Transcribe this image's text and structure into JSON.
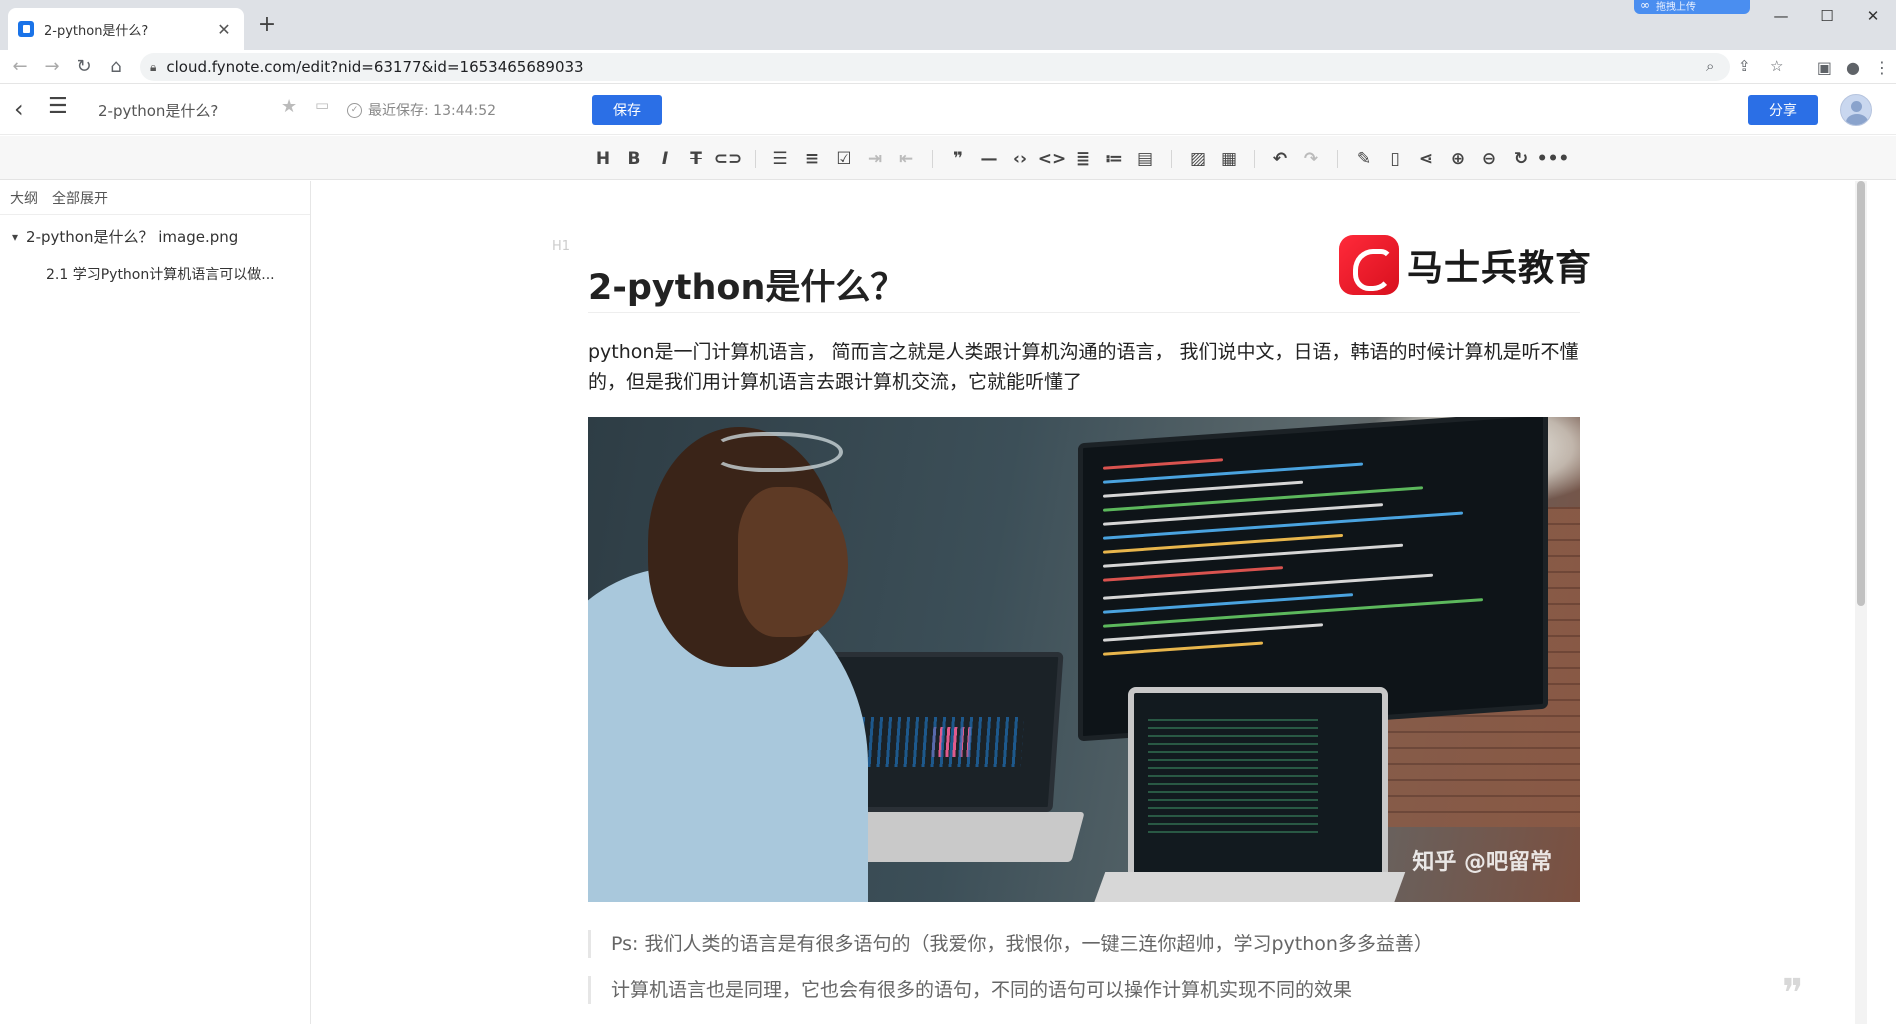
{
  "browser": {
    "tab_title": "2-python是什么?",
    "url": "cloud.fynote.com/edit?nid=63177&id=1653465689033",
    "upload_badge": "拖拽上传"
  },
  "app": {
    "doc_title": "2-python是什么?",
    "last_saved": "最近保存: 13:44:52",
    "save_label": "保存",
    "share_label": "分享"
  },
  "sidebar": {
    "tab_outline": "大纲",
    "tab_expand_all": "全部展开",
    "items": [
      {
        "label": "2-python是什么？ image.png",
        "level": 1
      },
      {
        "label": "2.1 学习Python计算机语言可以做...",
        "level": 2
      }
    ]
  },
  "toolbar": {
    "icons": [
      "heading-icon",
      "bold-icon",
      "italic-icon",
      "strikethrough-icon",
      "link-icon",
      "bullet-list-icon",
      "ordered-list-icon",
      "checklist-icon",
      "indent-icon",
      "outdent-icon",
      "quote-icon",
      "horizontal-rule-icon",
      "inline-code-icon",
      "code-block-icon",
      "align-icon",
      "format-icon",
      "paste-icon",
      "image-icon",
      "table-icon",
      "undo-icon",
      "redo-icon",
      "pen-icon",
      "export-icon",
      "mindmap-icon",
      "zoom-in-icon",
      "zoom-out-icon",
      "refresh-icon",
      "more-icon"
    ]
  },
  "editor": {
    "heading_marker": "H1",
    "heading": "2-python是什么？",
    "logo_text": "马士兵教育",
    "paragraph": "python是一门计算机语言， 简而言之就是人类跟计算机沟通的语言， 我们说中文，日语，韩语的时候计算机是听不懂的，但是我们用计算机语言去跟计算机交流，它就能听懂了",
    "image_watermark": "知乎 @吧留常",
    "quotes": [
      "Ps:  我们人类的语言是有很多语句的（我爱你，我恨你，一键三连你超帅，学习python多多益善）",
      "计算机语言也是同理，它也会有很多的语句，不同的语句可以操作计算机实现不同的效果"
    ]
  }
}
